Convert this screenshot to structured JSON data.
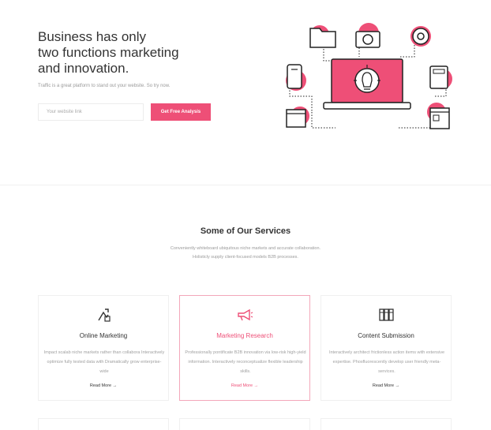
{
  "hero": {
    "title_line1": "Business has only",
    "title_line2": "two functions marketing",
    "title_line3": "and innovation.",
    "subtitle": "Traffic is a great platform to stand out your website. So try now.",
    "input_placeholder": "Your website link",
    "button_label": "Get Free Analysis"
  },
  "services": {
    "title": "Some of Our Services",
    "desc_line1": "Conveniently whiteboard ubiquitous niche markets and accurate collaboration.",
    "desc_line2": "Holisticly supply client-focused models B2B processes.",
    "cards": [
      {
        "title": "Online Marketing",
        "text": "Impact scalab niche markets rather than collabora Interactively optimize fully tested data with Dramatically grow enterprise-wide",
        "link": "Read More →",
        "icon": "strategy-icon"
      },
      {
        "title": "Marketing Research",
        "text": "Professionally pontificate B2B innovation via low-risk high-yield information. Interactively reconceptualize flexible leadership skills.",
        "link": "Read More →",
        "icon": "megaphone-icon"
      },
      {
        "title": "Content Submission",
        "text": "Interactively architect frictionless action items with extensive expertise. Phosfluorescently develop user friendly meta-services.",
        "link": "Read More →",
        "icon": "binders-icon"
      }
    ]
  },
  "colors": {
    "accent": "#ee4f77",
    "dark": "#333333",
    "muted": "#9a9a9a"
  }
}
